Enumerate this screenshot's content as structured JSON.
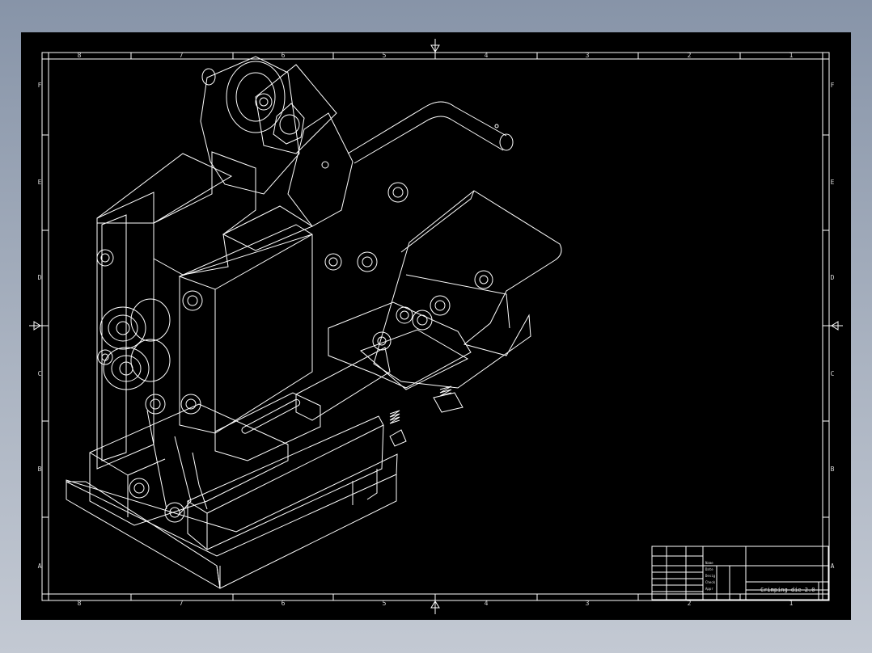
{
  "colors": {
    "background": "#000000",
    "lines": "#ffffff",
    "viewport": "#8e99ab"
  },
  "border": {
    "columns": [
      "8",
      "7",
      "6",
      "5",
      "4",
      "3",
      "2",
      "1"
    ],
    "rows": [
      "F",
      "E",
      "D",
      "C",
      "B",
      "A"
    ]
  },
  "title_block": {
    "title": "Crimping die 2.0",
    "small_text": [
      "Name",
      "Date",
      "Desig",
      "Check",
      "Appr"
    ]
  }
}
